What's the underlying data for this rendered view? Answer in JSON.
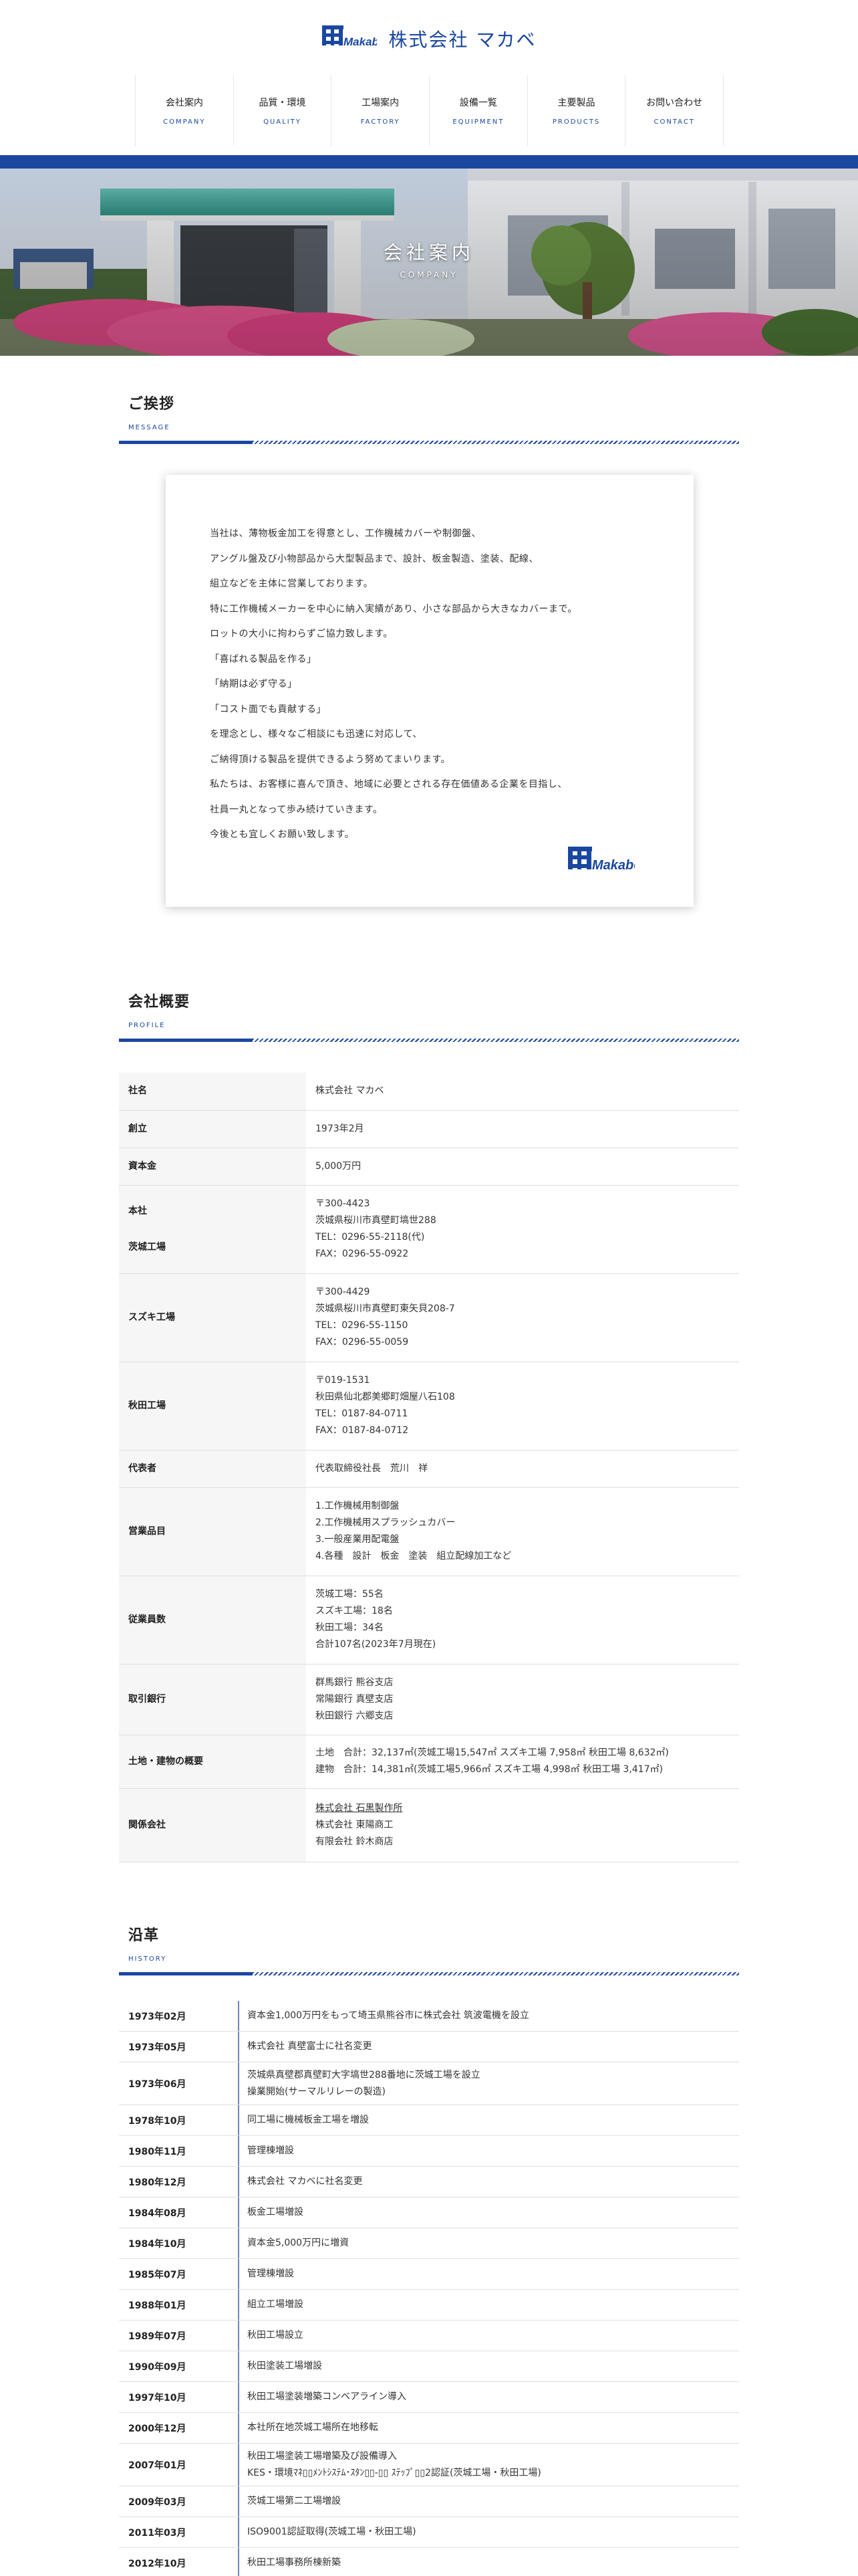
{
  "site": {
    "logo_wordmark": "Makabe",
    "title": "株式会社 マカベ"
  },
  "nav": [
    {
      "jp": "会社案内",
      "en": "COMPANY"
    },
    {
      "jp": "品質・環境",
      "en": "QUALITY"
    },
    {
      "jp": "工場案内",
      "en": "FACTORY"
    },
    {
      "jp": "設備一覧",
      "en": "EQUIPMENT"
    },
    {
      "jp": "主要製品",
      "en": "PRODUCTS"
    },
    {
      "jp": "お問い合わせ",
      "en": "CONTACT"
    }
  ],
  "hero": {
    "title": "会社案内",
    "subtitle": "COMPANY"
  },
  "message": {
    "heading": "ご挨拶",
    "heading_en": "MESSAGE",
    "lines": [
      "当社は、薄物板金加工を得意とし、工作機械カバーや制御盤、",
      "アングル盤及び小物部品から大型製品まで、設計、板金製造、塗装、配線、",
      "組立などを主体に営業しております。",
      "特に工作機械メーカーを中心に納入実績があり、小さな部品から大きなカバーまで。",
      "ロットの大小に拘わらずご協力致します。",
      "「喜ばれる製品を作る」",
      "「納期は必ず守る」",
      "「コスト面でも貢献する」",
      "を理念とし、様々なご相談にも迅速に対応して、",
      "ご納得頂ける製品を提供できるよう努めてまいります。",
      "私たちは、お客様に喜んで頂き、地域に必要とされる存在価値ある企業を目指し、",
      "社員一丸となって歩み続けていきます。",
      "今後とも宜しくお願い致します。"
    ]
  },
  "profile": {
    "heading": "会社概要",
    "heading_en": "PROFILE",
    "rows": [
      {
        "label": [
          "社名"
        ],
        "value": [
          "株式会社 マカベ"
        ]
      },
      {
        "label": [
          "創立"
        ],
        "value": [
          "1973年2月"
        ]
      },
      {
        "label": [
          "資本金"
        ],
        "value": [
          "5,000万円"
        ]
      },
      {
        "label": [
          "本社",
          "茨城工場"
        ],
        "value": [
          "〒300-4423",
          "茨城県桜川市真壁町塙世288",
          "TEL：0296-55-2118(代)",
          "FAX：0296-55-0922"
        ]
      },
      {
        "label": [
          "スズキ工場"
        ],
        "value": [
          "〒300-4429",
          "茨城県桜川市真壁町東矢貝208-7",
          "TEL：0296-55-1150",
          "FAX：0296-55-0059"
        ]
      },
      {
        "label": [
          "秋田工場"
        ],
        "value": [
          "〒019-1531",
          "秋田県仙北郡美郷町畑屋八石108",
          "TEL：0187-84-0711",
          "FAX：0187-84-0712"
        ]
      },
      {
        "label": [
          "代表者"
        ],
        "value": [
          "代表取締役社長　荒川　祥"
        ]
      },
      {
        "label": [
          "営業品目"
        ],
        "value": [
          "1.工作機械用制御盤",
          "2.工作機械用スプラッシュカバー",
          "3.一般産業用配電盤",
          "4.各種　設計　板金　塗装　組立配線加工など"
        ]
      },
      {
        "label": [
          "従業員数"
        ],
        "value": [
          "茨城工場：55名",
          "スズキ工場：18名",
          "秋田工場：34名",
          "合計107名(2023年7月現在)"
        ]
      },
      {
        "label": [
          "取引銀行"
        ],
        "value": [
          "群馬銀行 熊谷支店",
          "常陽銀行 真壁支店",
          "秋田銀行 六郷支店"
        ]
      },
      {
        "label": [
          "土地・建物の概要"
        ],
        "value": [
          "土地　合計：32,137㎡(茨城工場15,547㎡ スズキ工場 7,958㎡ 秋田工場 8,632㎡)",
          "建物　合計：14,381㎡(茨城工場5,966㎡ スズキ工場 4,998㎡ 秋田工場 3,417㎡)"
        ]
      },
      {
        "label": [
          "関係会社"
        ],
        "value": [
          "株式会社 石黒製作所",
          "株式会社 東陽商工",
          "有限会社 鈴木商店"
        ],
        "link_first": true
      }
    ]
  },
  "history": {
    "heading": "沿革",
    "heading_en": "HISTORY",
    "rows": [
      {
        "date": "1973年02月",
        "text": [
          "資本金1,000万円をもって埼玉県熊谷市に株式会社 筑波電機を設立"
        ]
      },
      {
        "date": "1973年05月",
        "text": [
          "株式会社 真壁富士に社名変更"
        ]
      },
      {
        "date": "1973年06月",
        "text": [
          "茨城県真壁郡真壁町大字塙世288番地に茨城工場を設立",
          "操業開始(サーマルリレーの製造)"
        ]
      },
      {
        "date": "1978年10月",
        "text": [
          "同工場に機械板金工場を増設"
        ]
      },
      {
        "date": "1980年11月",
        "text": [
          "管理棟増設"
        ]
      },
      {
        "date": "1980年12月",
        "text": [
          "株式会社 マカベに社名変更"
        ]
      },
      {
        "date": "1984年08月",
        "text": [
          "板金工場増設"
        ]
      },
      {
        "date": "1984年10月",
        "text": [
          "資本金5,000万円に増資"
        ]
      },
      {
        "date": "1985年07月",
        "text": [
          "管理棟増設"
        ]
      },
      {
        "date": "1988年01月",
        "text": [
          "組立工場増設"
        ]
      },
      {
        "date": "1989年07月",
        "text": [
          "秋田工場設立"
        ]
      },
      {
        "date": "1990年09月",
        "text": [
          "秋田塗装工場増設"
        ]
      },
      {
        "date": "1997年10月",
        "text": [
          "秋田工場塗装増築コンベアライン導入"
        ]
      },
      {
        "date": "2000年12月",
        "text": [
          "本社所在地茨城工場所在地移転"
        ]
      },
      {
        "date": "2007年01月",
        "text": [
          "秋田工場塗装工場増築及び設備導入",
          "KES・環境ﾏﾈ▯▯ﾒﾝﾄｼｽﾃﾑ･ｽﾀﾝ▯▯-▯▯ ｽﾃｯﾌﾟ▯▯2認証(茨城工場・秋田工場)"
        ]
      },
      {
        "date": "2009年03月",
        "text": [
          "茨城工場第二工場増設"
        ]
      },
      {
        "date": "2011年03月",
        "text": [
          "ISO9001認証取得(茨城工場・秋田工場)"
        ]
      },
      {
        "date": "2012年10月",
        "text": [
          "秋田工場事務所棟新築"
        ]
      }
    ]
  },
  "colors": {
    "brand_blue": "#1a47a0",
    "table_header_bg": "#f6f6f6",
    "rule": "#dcdfe4"
  },
  "icons": {
    "logo": "makabe-logo-icon",
    "card_logo": "makabe-logo-icon"
  }
}
